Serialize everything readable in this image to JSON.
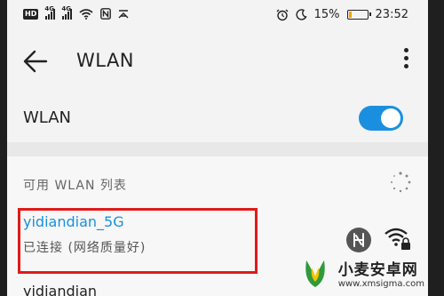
{
  "status_bar": {
    "left_badge": "HD",
    "signal1_tag": "4G",
    "signal2_tag": "4G",
    "icons": [
      "hd-icon",
      "signal-4g-icon",
      "signal-4g-icon",
      "wifi-icon",
      "nfc-icon",
      "no-sim-icon"
    ],
    "right_icons": [
      "alarm-icon",
      "moon-icon"
    ],
    "battery_percent": "15%",
    "battery_level": 0.15,
    "time": "23:52"
  },
  "app_bar": {
    "title": "WLAN"
  },
  "wlan_toggle": {
    "label": "WLAN",
    "enabled": true
  },
  "networks": {
    "section_title": "可用 WLAN 列表",
    "connected": {
      "ssid": "yidiandian_5G",
      "status": "已连接 (网络质量好)"
    },
    "next": {
      "ssid": "yidiandian"
    }
  },
  "watermark": {
    "title": "小麦安卓网",
    "url": "www.xmsigma.com"
  },
  "colors": {
    "accent": "#1a8fe0",
    "highlight": "#e01a1a",
    "battery": "#f5a000"
  }
}
